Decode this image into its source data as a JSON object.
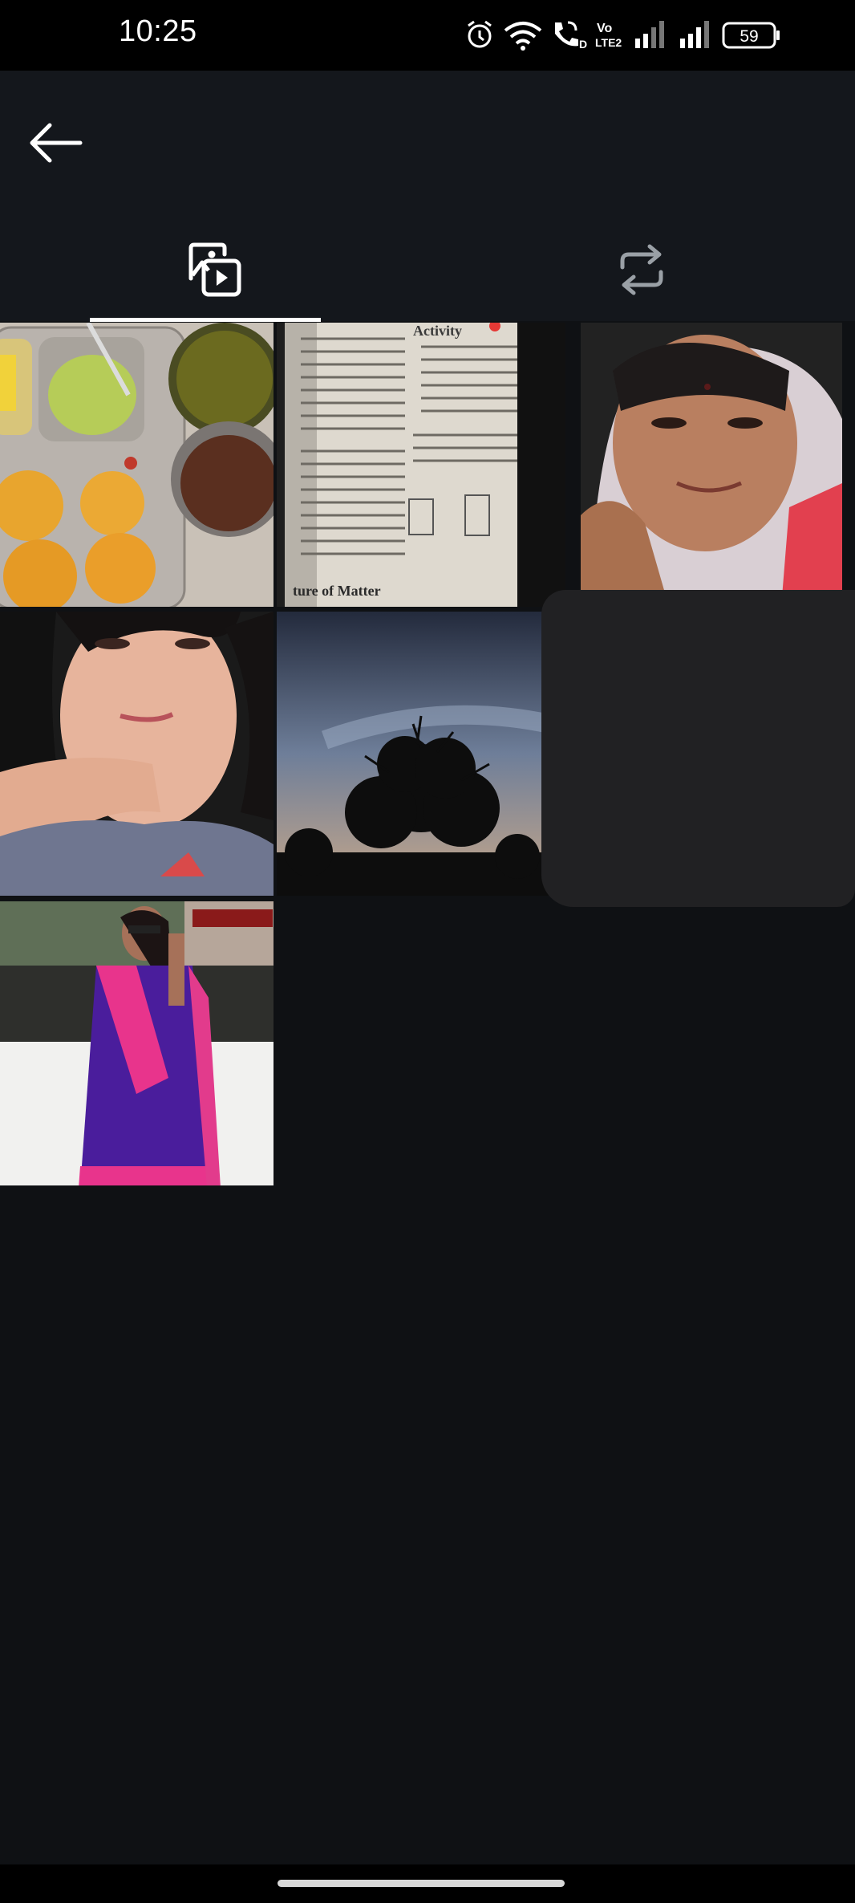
{
  "status_bar": {
    "time": "10:25",
    "icons": [
      "alarm-icon",
      "wifi-icon",
      "wifi-call-icon",
      "volte-icon",
      "signal-icon",
      "signal-icon",
      "battery-icon"
    ],
    "volte_text": "Vo LTE2",
    "battery_level": "59"
  },
  "header": {
    "back_icon": "arrow-left-icon"
  },
  "tabs": [
    {
      "icon": "posts-media-icon",
      "selected": true
    },
    {
      "icon": "repost-icon",
      "selected": false
    }
  ],
  "grid": {
    "items": [
      {
        "subject": "food thali photo"
      },
      {
        "subject": "textbook page photo",
        "visible_text": "Activity"
      },
      {
        "subject": "selfie portrait"
      },
      {
        "subject": "selfie portrait"
      },
      {
        "subject": "tree silhouette at dusk"
      },
      {
        "subject": "redacted"
      },
      {
        "subject": "person in saree"
      }
    ]
  },
  "colors": {
    "background": "#0f1114",
    "header": "#14171c",
    "accent_white": "#ffffff",
    "inactive_icon": "#9aa0a6"
  }
}
